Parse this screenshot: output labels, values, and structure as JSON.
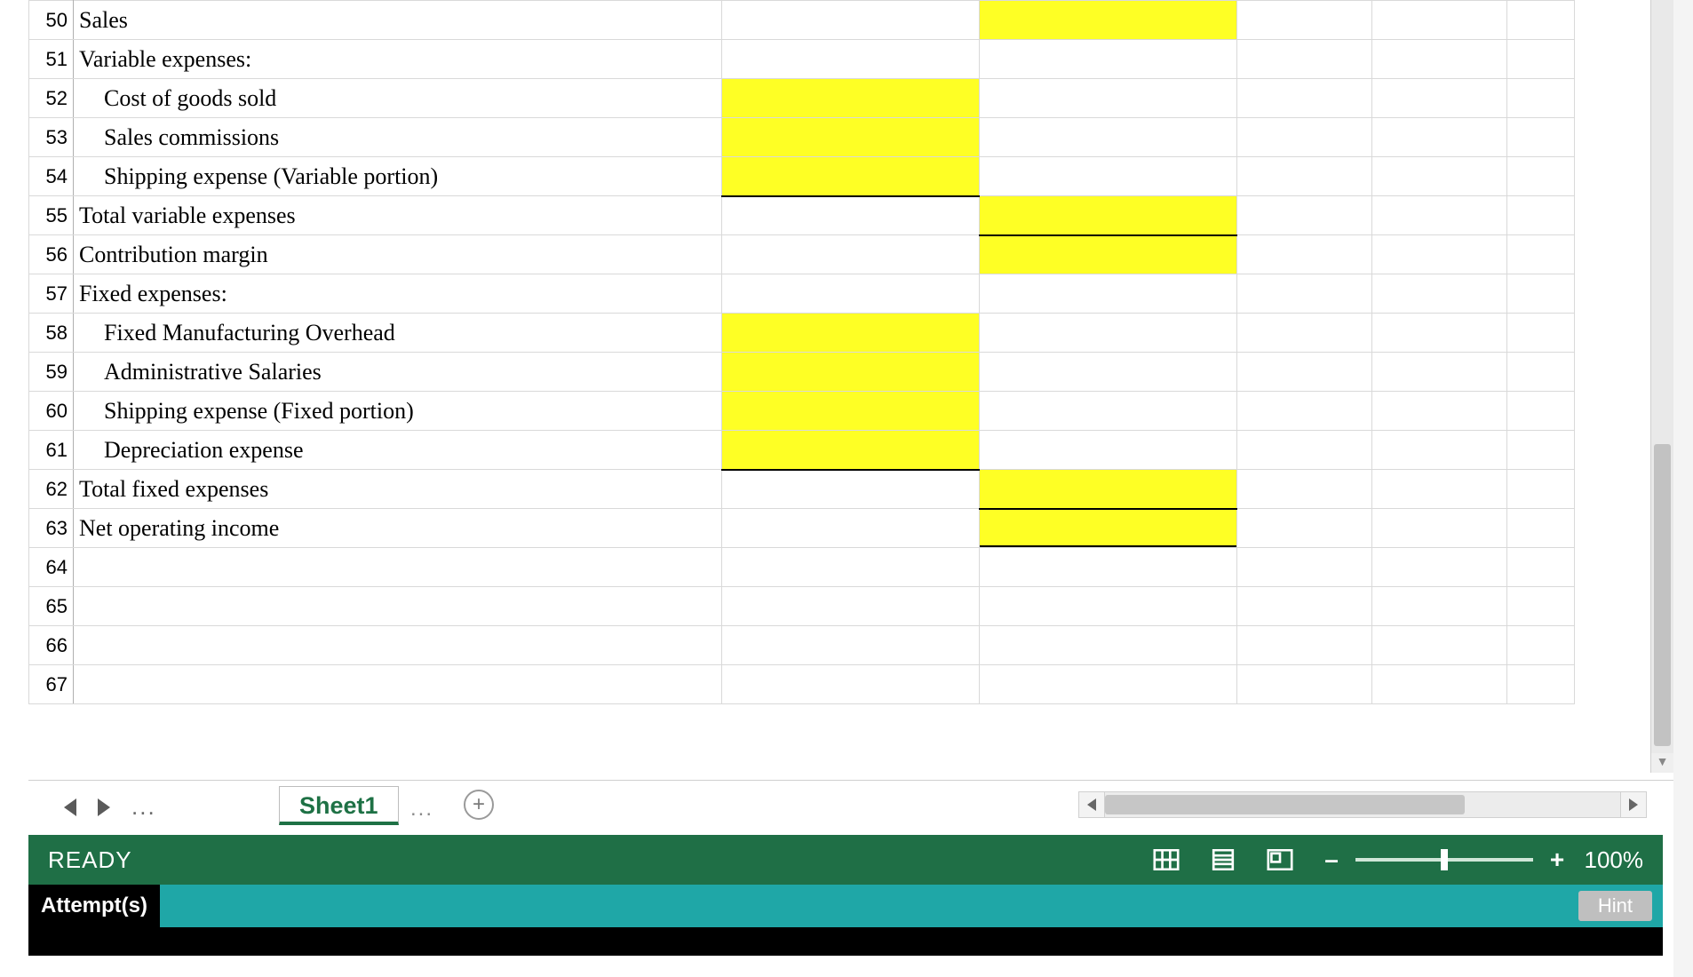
{
  "rows": [
    {
      "num": "50",
      "label": "Sales",
      "indent": 0,
      "hlB": false,
      "hlC": true
    },
    {
      "num": "51",
      "label": "Variable expenses:",
      "indent": 0
    },
    {
      "num": "52",
      "label": "Cost of goods sold",
      "indent": 1,
      "hlB": true
    },
    {
      "num": "53",
      "label": "Sales commissions",
      "indent": 1,
      "hlB": true
    },
    {
      "num": "54",
      "label": "Shipping expense (Variable portion)",
      "indent": 1,
      "hlB": true,
      "borderB_B": "single"
    },
    {
      "num": "55",
      "label": "Total variable expenses",
      "indent": 0,
      "hlC": true,
      "borderC_B": "single"
    },
    {
      "num": "56",
      "label": "Contribution margin",
      "indent": 0,
      "hlC": true
    },
    {
      "num": "57",
      "label": "Fixed expenses:",
      "indent": 0
    },
    {
      "num": "58",
      "label": "Fixed Manufacturing Overhead",
      "indent": 1,
      "hlB": true
    },
    {
      "num": "59",
      "label": "Administrative Salaries",
      "indent": 1,
      "hlB": true
    },
    {
      "num": "60",
      "label": "Shipping expense (Fixed portion)",
      "indent": 1,
      "hlB": true
    },
    {
      "num": "61",
      "label": "Depreciation expense",
      "indent": 1,
      "hlB": true,
      "borderB_B": "single"
    },
    {
      "num": "62",
      "label": "Total fixed expenses",
      "indent": 0,
      "hlC": true,
      "borderC_B": "single"
    },
    {
      "num": "63",
      "label": "Net operating income",
      "indent": 0,
      "hlC": true,
      "borderC_B": "double"
    },
    {
      "num": "64",
      "label": "",
      "indent": 0
    },
    {
      "num": "65",
      "label": "",
      "indent": 0
    },
    {
      "num": "66",
      "label": "",
      "indent": 0
    },
    {
      "num": "67",
      "label": "",
      "indent": 0
    }
  ],
  "tabs": {
    "active": "Sheet1"
  },
  "status": {
    "ready": "READY",
    "zoom": "100%"
  },
  "attempts": {
    "label": "Attempt(s)",
    "hint": "Hint"
  }
}
